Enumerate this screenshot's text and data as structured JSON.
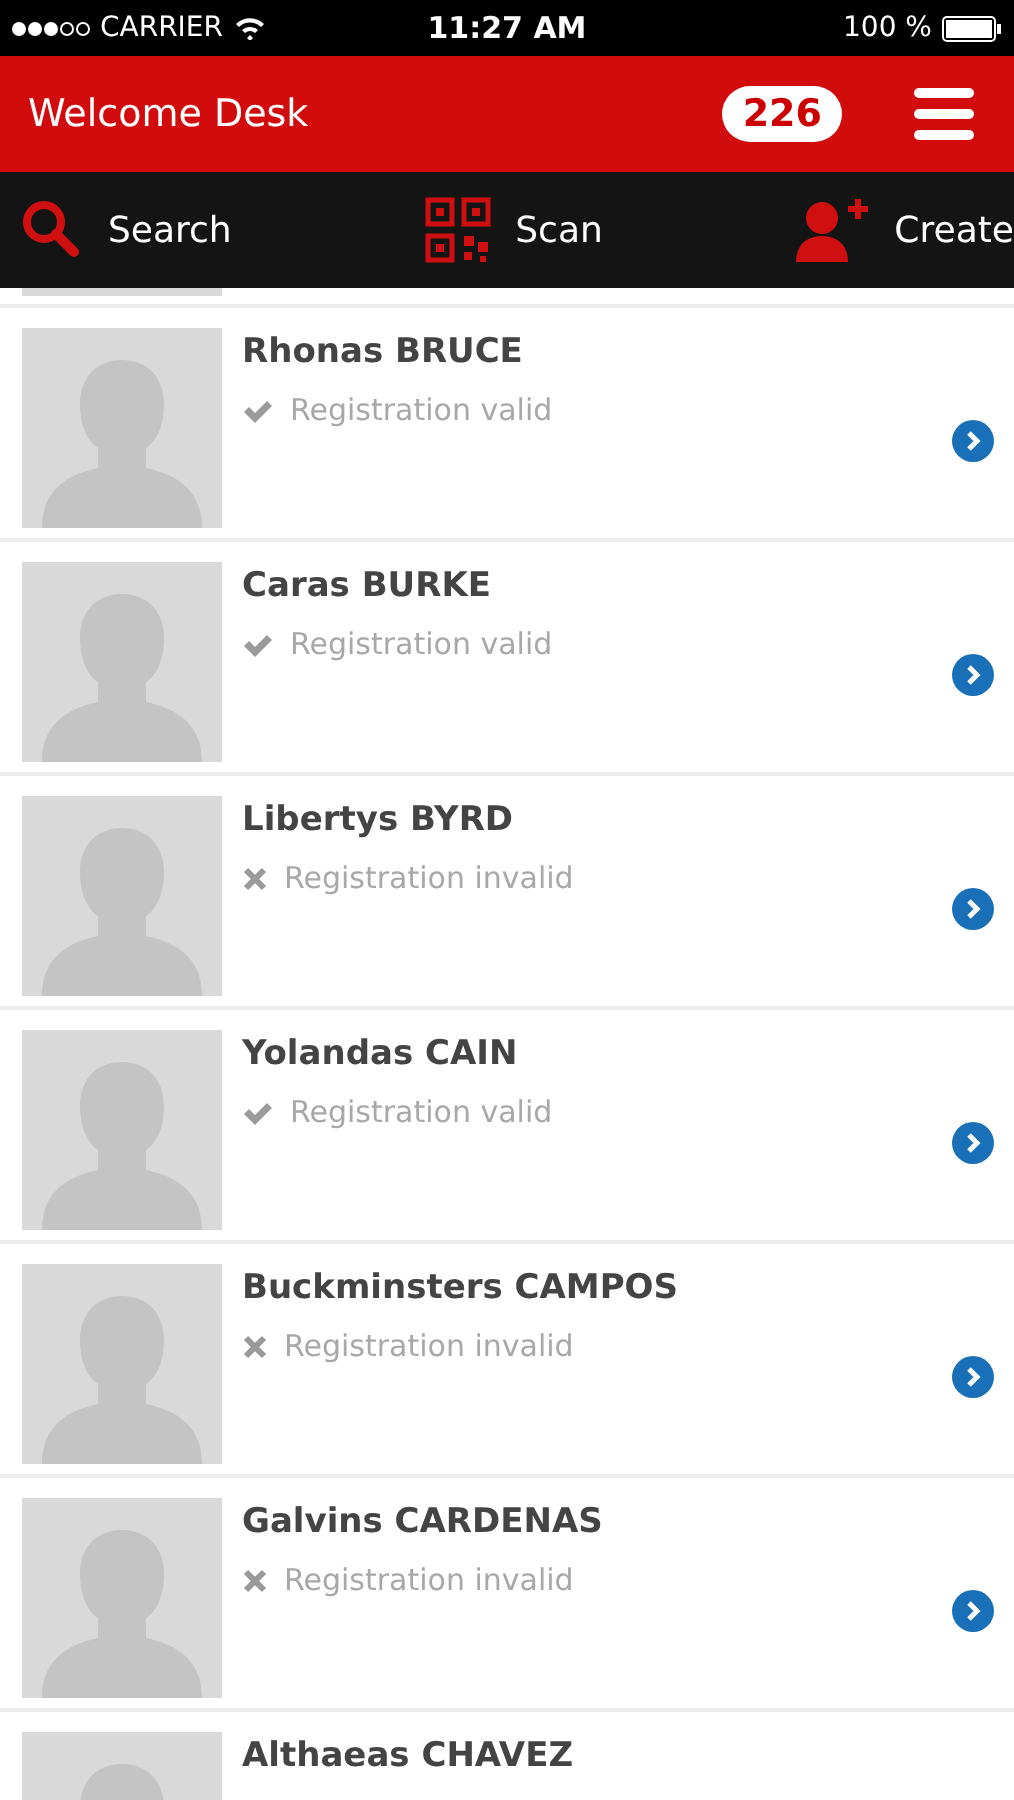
{
  "status_bar": {
    "carrier": "CARRIER",
    "time": "11:27 AM",
    "battery": "100 %"
  },
  "header": {
    "title": "Welcome Desk",
    "count": "226"
  },
  "toolbar": [
    {
      "kind": "search",
      "label": "Search"
    },
    {
      "kind": "scan",
      "label": "Scan"
    },
    {
      "kind": "create",
      "label": "Create"
    }
  ],
  "people": [
    {
      "name": "Rhonas BRUCE",
      "valid": true,
      "status": "Registration valid"
    },
    {
      "name": "Caras BURKE",
      "valid": true,
      "status": "Registration valid"
    },
    {
      "name": "Libertys BYRD",
      "valid": false,
      "status": "Registration invalid"
    },
    {
      "name": "Yolandas CAIN",
      "valid": true,
      "status": "Registration valid"
    },
    {
      "name": "Buckminsters CAMPOS",
      "valid": false,
      "status": "Registration invalid"
    },
    {
      "name": "Galvins CARDENAS",
      "valid": false,
      "status": "Registration invalid"
    },
    {
      "name": "Althaeas CHAVEZ"
    }
  ]
}
